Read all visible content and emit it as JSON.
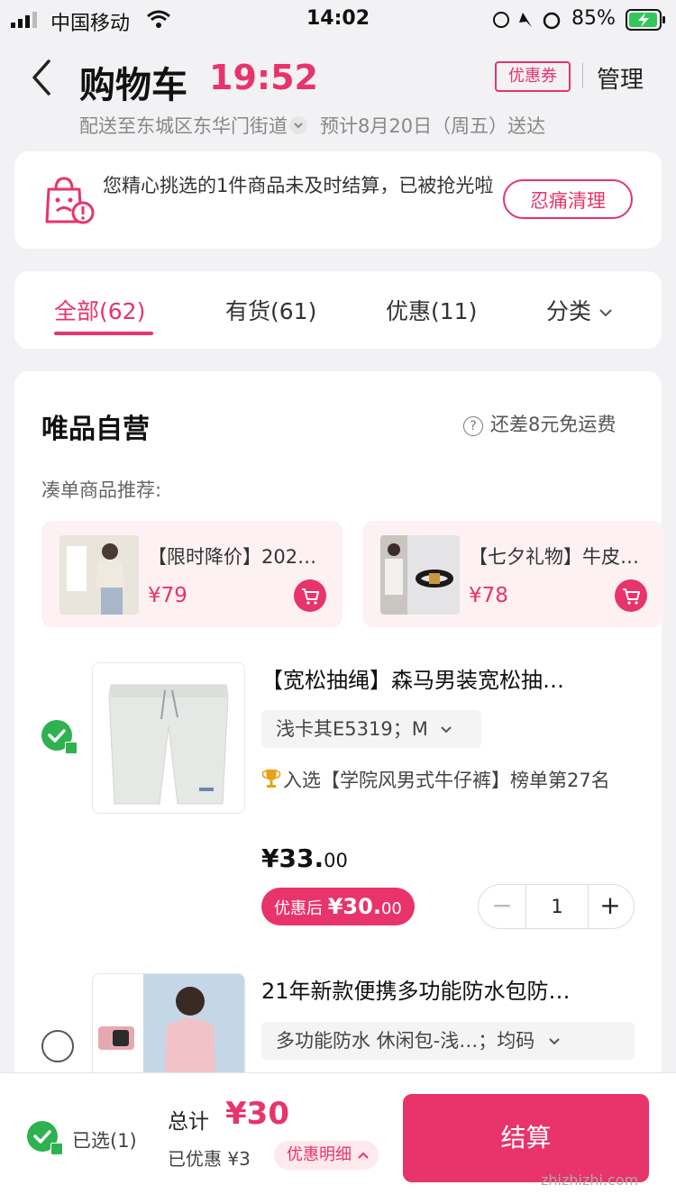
{
  "status_bar": {
    "carrier": "中国移动",
    "time": "14:02",
    "battery": "85%"
  },
  "header": {
    "title": "购物车",
    "countdown": "19:52",
    "coupon": "优惠券",
    "manage": "管理",
    "delivery_address": "配送至东城区东华门街道",
    "delivery_eta": "预计8月20日（周五）送达"
  },
  "notice": {
    "message": "您精心挑选的1件商品未及时结算，已被抢光啦",
    "action": "忍痛清理"
  },
  "tabs": [
    {
      "label": "全部(62)"
    },
    {
      "label": "有货(61)"
    },
    {
      "label": "优惠(11)"
    },
    {
      "label": "分类"
    }
  ],
  "store": {
    "name": "唯品自营",
    "shipping_hint": "还差8元免运费",
    "recommend_heading": "凑单商品推荐:",
    "recommendations": [
      {
        "title": "【限时降价】202…",
        "price": "¥79"
      },
      {
        "title": "【七夕礼物】牛皮…",
        "price": "¥78"
      }
    ]
  },
  "items": [
    {
      "title": "【宽松抽绳】森马男装宽松抽…",
      "spec": "浅卡其E5319；M",
      "rank": "入选【学院风男式牛仔裤】榜单第27名",
      "price_main": "¥33.",
      "price_cents": "00",
      "discount_label": "优惠后",
      "discount_price": "¥30.",
      "discount_cents": "00",
      "qty_minus": "−",
      "qty": "1",
      "qty_plus": "+"
    },
    {
      "title": "21年新款便携多功能防水包防…",
      "spec": "多功能防水 休闲包-浅…；均码"
    }
  ],
  "footer": {
    "selected": "已选(1)",
    "total_label": "总计",
    "total_value": "¥30",
    "saved": "已优惠 ¥3",
    "detail": "优惠明细",
    "checkout": "结算",
    "watermark": "zhizhizhi.com"
  },
  "colors": {
    "accent": "#e8336b",
    "check": "#2eb24f"
  }
}
